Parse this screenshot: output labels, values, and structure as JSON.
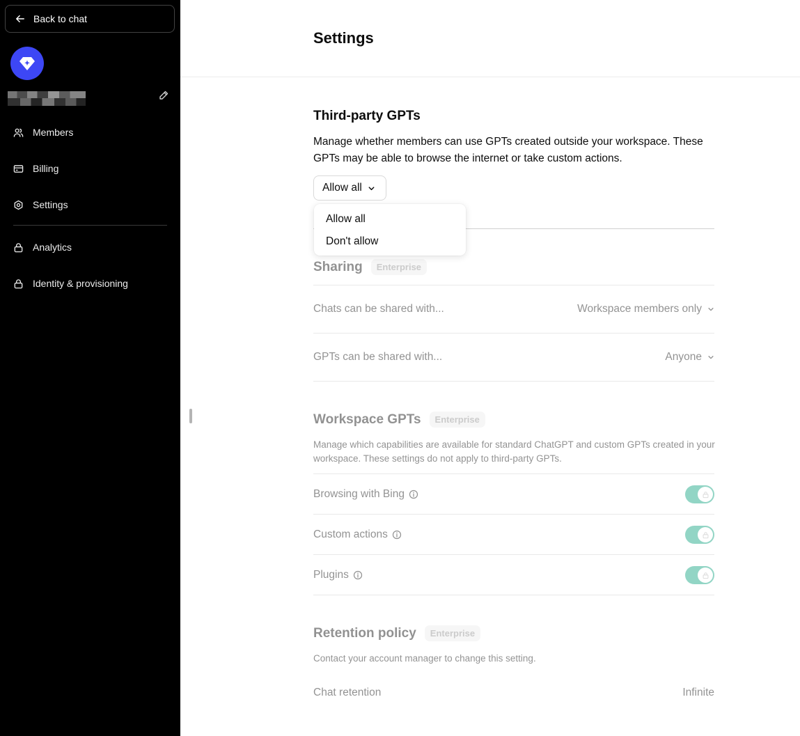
{
  "sidebar": {
    "back_label": "Back to chat",
    "logo_color": "#3d47f5",
    "items": [
      {
        "label": "Members",
        "icon": "users-icon"
      },
      {
        "label": "Billing",
        "icon": "credit-card-icon"
      },
      {
        "label": "Settings",
        "icon": "gear-icon"
      },
      {
        "label": "Analytics",
        "icon": "lock-icon"
      },
      {
        "label": "Identity & provisioning",
        "icon": "lock-icon"
      }
    ]
  },
  "page": {
    "title": "Settings"
  },
  "third_party": {
    "title": "Third-party GPTs",
    "description": "Manage whether members can use GPTs created outside your workspace. These GPTs may be able to browse the internet or take custom actions.",
    "selected": "Allow all",
    "options": [
      "Allow all",
      "Don't allow"
    ]
  },
  "sharing": {
    "title": "Sharing",
    "badge": "Enterprise",
    "rows": [
      {
        "label": "Chats can be shared with...",
        "value": "Workspace members only"
      },
      {
        "label": "GPTs can be shared with...",
        "value": "Anyone"
      }
    ]
  },
  "workspace_gpts": {
    "title": "Workspace GPTs",
    "badge": "Enterprise",
    "description": "Manage which capabilities are available for standard ChatGPT and custom GPTs created in your workspace. These settings do not apply to third-party GPTs.",
    "toggles": [
      {
        "label": "Browsing with Bing",
        "enabled": true
      },
      {
        "label": "Custom actions",
        "enabled": true
      },
      {
        "label": "Plugins",
        "enabled": true
      }
    ]
  },
  "retention": {
    "title": "Retention policy",
    "badge": "Enterprise",
    "description": "Contact your account manager to change this setting.",
    "row_label": "Chat retention",
    "row_value": "Infinite"
  },
  "colors": {
    "accent": "#10a37f",
    "sidebar_bg": "#000000"
  }
}
